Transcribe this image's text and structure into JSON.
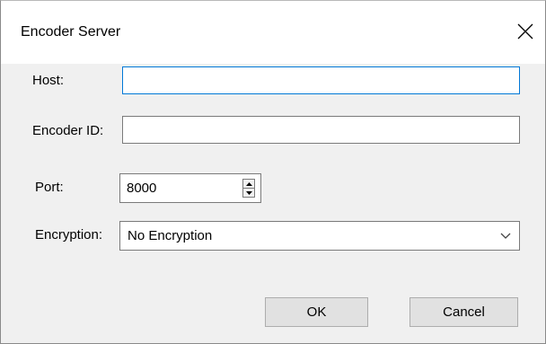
{
  "window": {
    "title": "Encoder Server"
  },
  "form": {
    "host": {
      "label": "Host:",
      "value": ""
    },
    "encoder_id": {
      "label": "Encoder ID:",
      "value": ""
    },
    "port": {
      "label": "Port:",
      "value": "8000"
    },
    "encryption": {
      "label": "Encryption:",
      "selected": "No Encryption"
    }
  },
  "buttons": {
    "ok": "OK",
    "cancel": "Cancel"
  },
  "icons": {
    "close": "close-icon",
    "spin_up": "spin-up-icon",
    "spin_down": "spin-down-icon",
    "dropdown": "chevron-down-icon"
  },
  "colors": {
    "focus_border": "#0078d7",
    "title_bg": "#ffffff",
    "dialog_bg": "#f0f0f0"
  }
}
